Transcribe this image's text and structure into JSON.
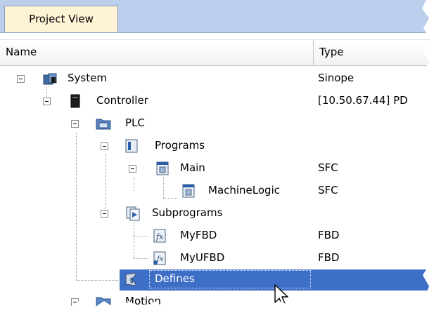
{
  "tab": {
    "label": "Project View"
  },
  "columns": {
    "name": "Name",
    "type": "Type"
  },
  "tree": [
    {
      "label": "System",
      "type": "Sinope",
      "icon": "system-icon"
    },
    {
      "label": "Controller",
      "type": "[10.50.67.44] PD",
      "icon": "controller-icon"
    },
    {
      "label": "PLC",
      "type": "",
      "icon": "plc-folder-icon"
    },
    {
      "label": "Programs",
      "type": "",
      "icon": "programs-icon"
    },
    {
      "label": "Main",
      "type": "SFC",
      "icon": "program-icon"
    },
    {
      "label": "MachineLogic",
      "type": "SFC",
      "icon": "program-icon"
    },
    {
      "label": "Subprograms",
      "type": "",
      "icon": "subprograms-icon"
    },
    {
      "label": "MyFBD",
      "type": "FBD",
      "icon": "fbd-icon"
    },
    {
      "label": "MyUFBD",
      "type": "FBD",
      "icon": "ufbd-icon"
    },
    {
      "label": "Defines",
      "type": "",
      "icon": "defines-icon",
      "selected": true
    },
    {
      "label": "Motion",
      "type": "",
      "icon": "motion-icon"
    }
  ],
  "colors": {
    "selection": "#3d6fc6",
    "tabstrip": "#bcd0ee",
    "active_tab": "#fff3d6"
  }
}
